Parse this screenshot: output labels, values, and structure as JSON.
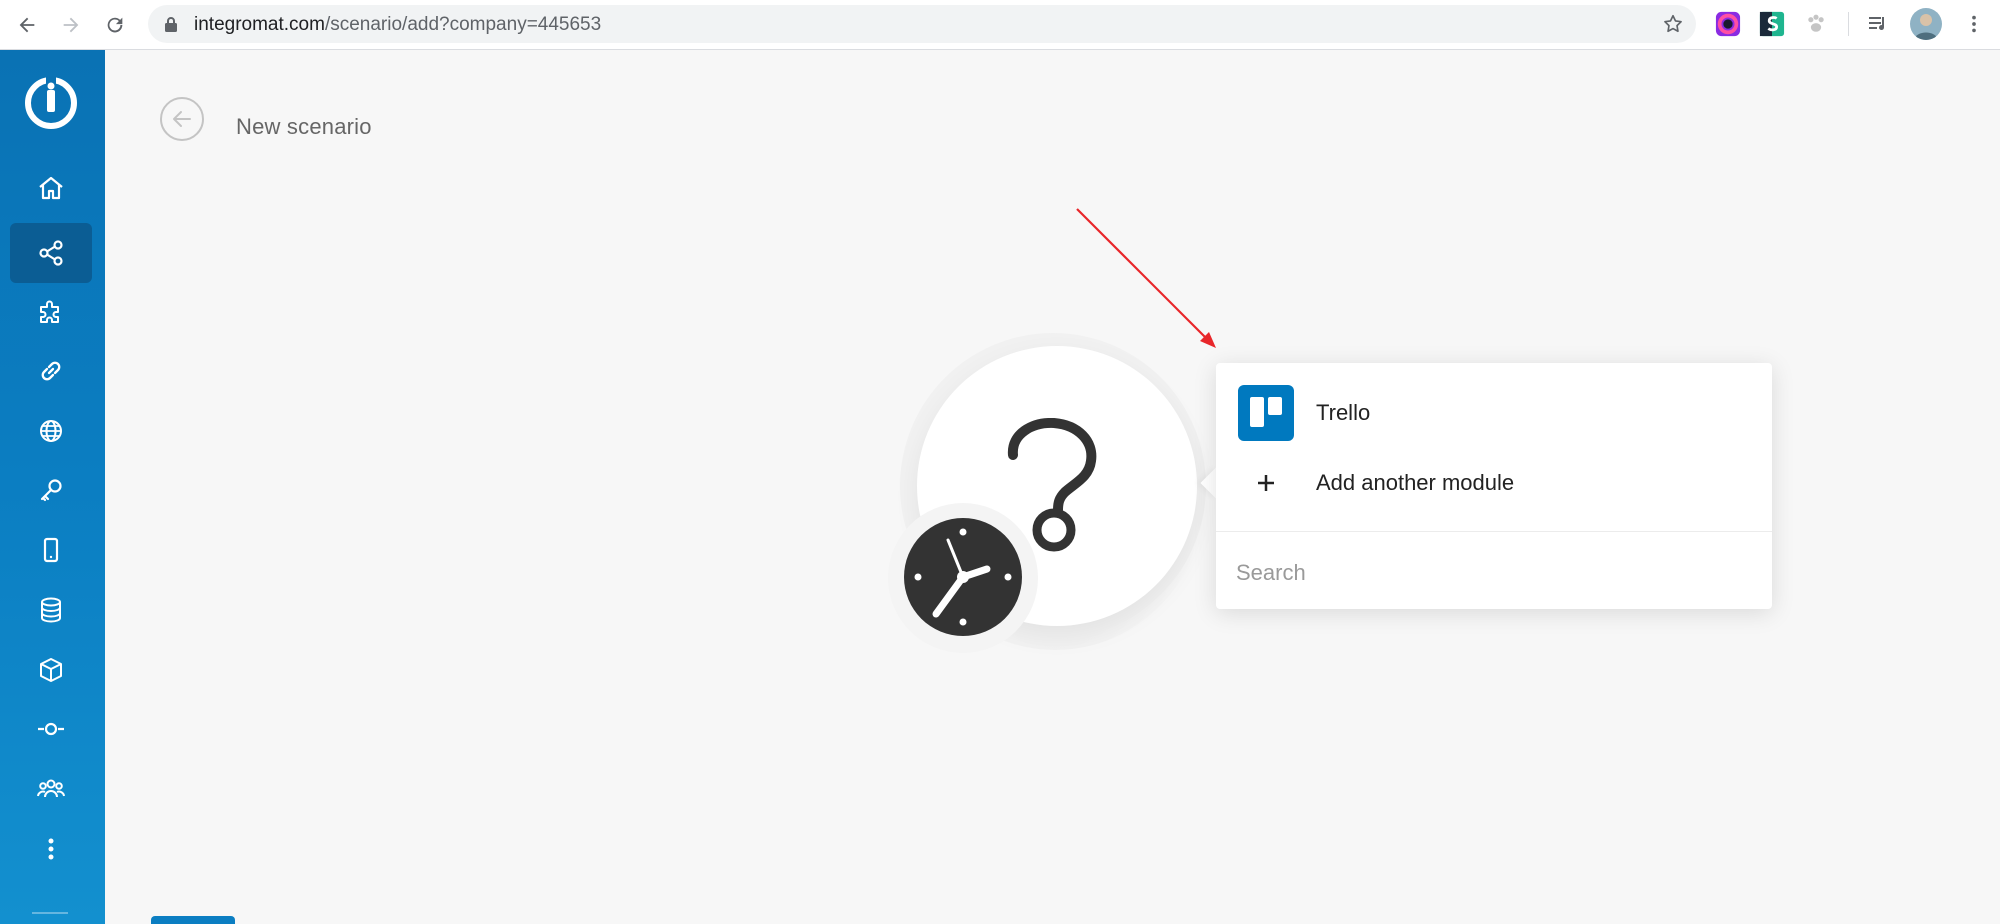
{
  "browser": {
    "url_host": "integromat.com",
    "url_path": "/scenario/add?company=445653"
  },
  "sidebar": {
    "items": [
      {
        "icon": "home-icon",
        "active": false
      },
      {
        "icon": "scenarios-icon",
        "active": true
      },
      {
        "icon": "templates-icon",
        "active": false
      },
      {
        "icon": "connections-icon",
        "active": false
      },
      {
        "icon": "webhooks-icon",
        "active": false
      },
      {
        "icon": "keys-icon",
        "active": false
      },
      {
        "icon": "devices-icon",
        "active": false
      },
      {
        "icon": "data-stores-icon",
        "active": false
      },
      {
        "icon": "data-structures-icon",
        "active": false
      },
      {
        "icon": "custom-apps-icon",
        "active": false
      },
      {
        "icon": "team-icon",
        "active": false
      },
      {
        "icon": "more-icon",
        "active": false
      }
    ]
  },
  "header": {
    "title": "New scenario"
  },
  "popup": {
    "items": [
      {
        "label": "Trello",
        "icon": "trello-logo"
      },
      {
        "label": "Add another module",
        "icon": "plus-icon"
      }
    ],
    "search_placeholder": "Search"
  },
  "colors": {
    "sidebar": "#0b7ec2",
    "trello": "#0079bf",
    "annotation": "#e8262a"
  }
}
